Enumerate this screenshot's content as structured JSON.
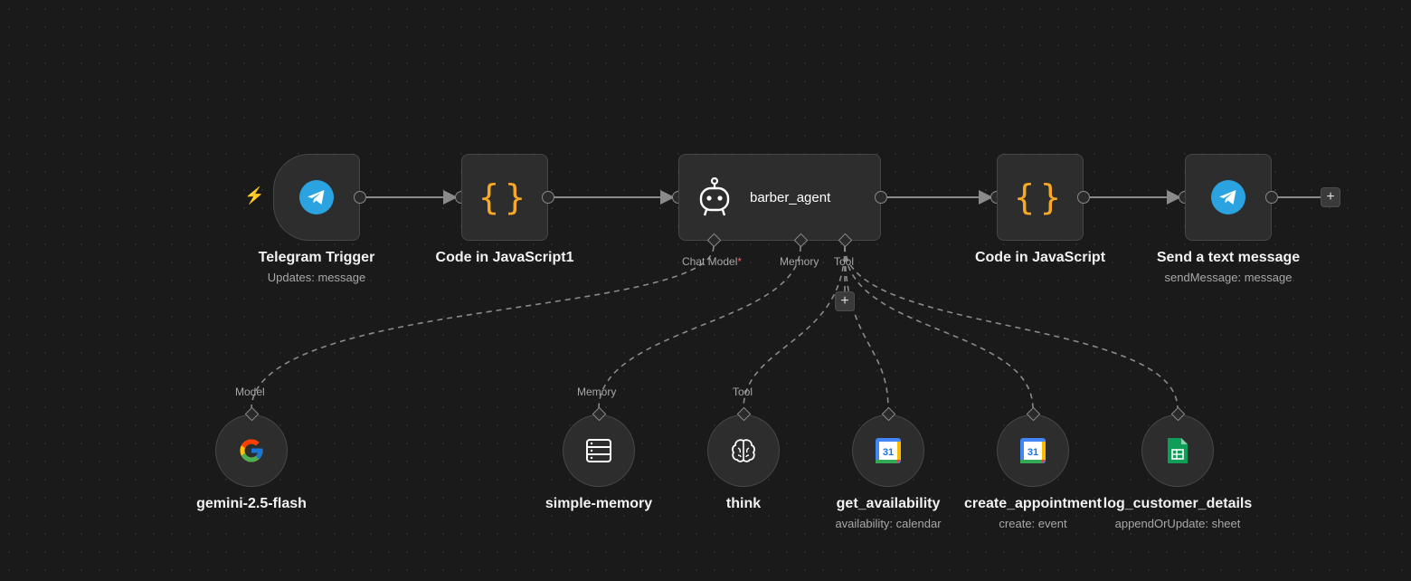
{
  "nodes": {
    "telegram_trigger": {
      "label": "Telegram Trigger",
      "sub": "Updates: message",
      "icon": "telegram-icon"
    },
    "code_js1": {
      "label": "Code in JavaScript1",
      "icon": "code-braces-icon"
    },
    "agent": {
      "label": "barber_agent",
      "icon": "robot-icon"
    },
    "code_js": {
      "label": "Code in JavaScript",
      "icon": "code-braces-icon"
    },
    "send_message": {
      "label": "Send a text message",
      "sub": "sendMessage: message",
      "icon": "telegram-icon"
    },
    "gemini": {
      "label": "gemini-2.5-flash",
      "icon": "google-icon"
    },
    "memory": {
      "label": "simple-memory",
      "icon": "database-icon"
    },
    "think": {
      "label": "think",
      "icon": "brain-icon"
    },
    "get_availability": {
      "label": "get_availability",
      "sub": "availability: calendar",
      "icon": "google-calendar-icon"
    },
    "create_appointment": {
      "label": "create_appointment",
      "sub": "create: event",
      "icon": "google-calendar-icon"
    },
    "log_customer": {
      "label": "log_customer_details",
      "sub": "appendOrUpdate: sheet",
      "icon": "google-sheets-icon"
    }
  },
  "ports": {
    "chat_model": "Chat Model",
    "chat_model_required": "*",
    "memory": "Memory",
    "tool": "Tool"
  },
  "sub_ports": {
    "model": "Model",
    "memory": "Memory",
    "tool": "Tool"
  },
  "buttons": {
    "add": "+"
  },
  "calendar_day": "31",
  "colors": {
    "background": "#1a1a1a",
    "node": "#2d2d2d",
    "telegram": "#2aa3e0",
    "code": "#f7a825",
    "trigger_bolt": "#ff6b1a",
    "required": "#ff5a5a"
  }
}
